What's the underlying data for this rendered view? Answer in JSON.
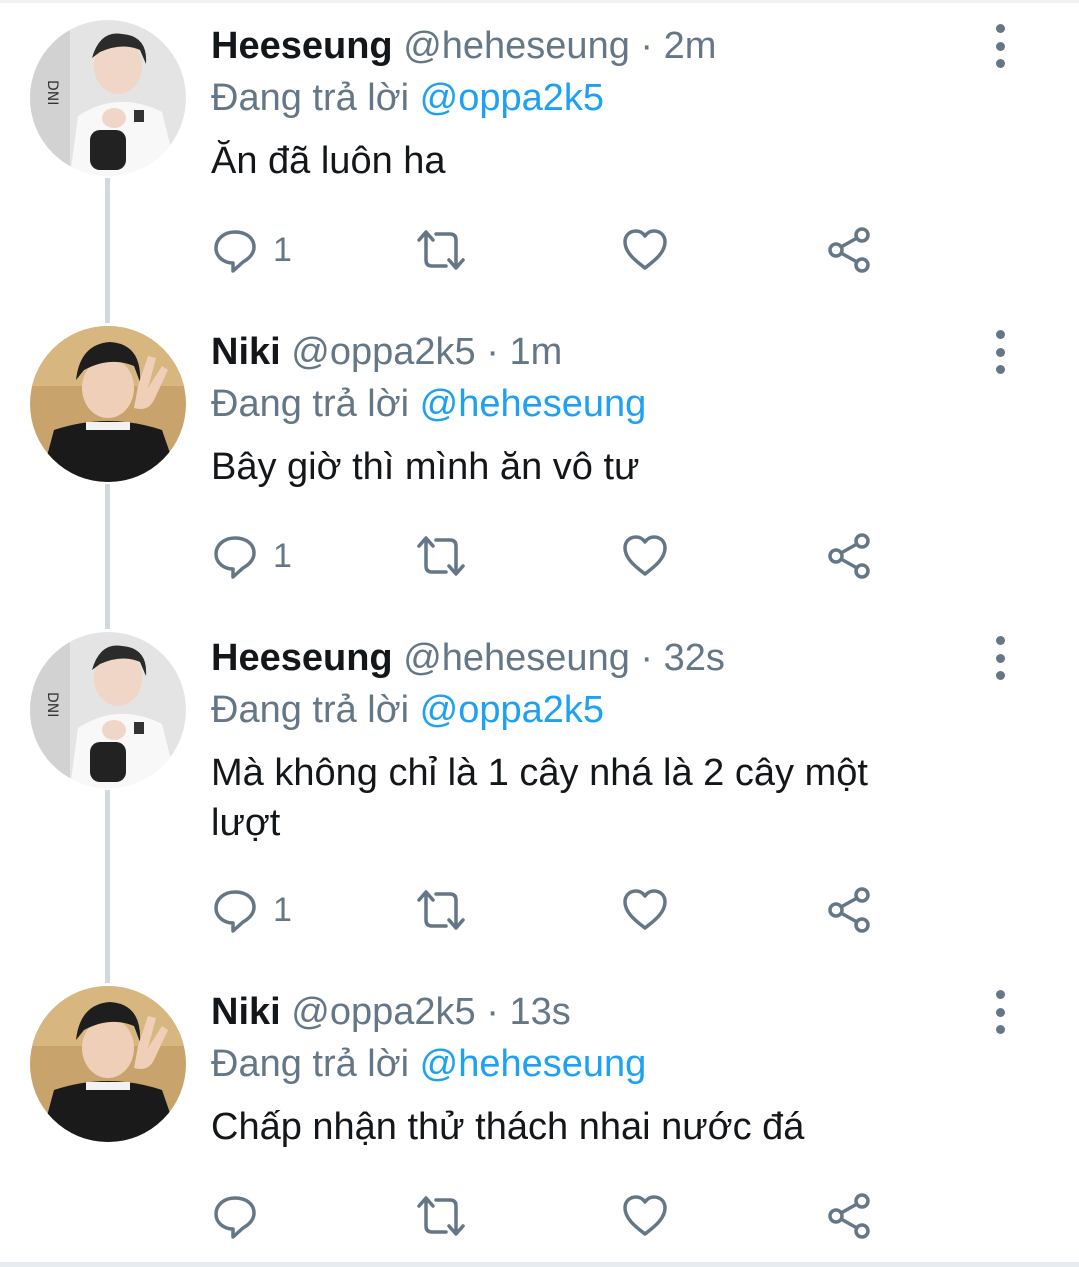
{
  "tweets": [
    {
      "name": "Heeseung",
      "handle": "@heheseung",
      "separator": "·",
      "time": "2m",
      "reply_prefix": "Đang trả lời",
      "reply_to": "@oppa2k5",
      "text": "Ăn đã luôn ha",
      "reply_count": "1",
      "avatar": "heeseung-avatar"
    },
    {
      "name": "Niki",
      "handle": "@oppa2k5",
      "separator": "·",
      "time": "1m",
      "reply_prefix": "Đang trả lời",
      "reply_to": "@heheseung",
      "text": "Bây giờ thì mình ăn vô tư",
      "reply_count": "1",
      "avatar": "niki-avatar"
    },
    {
      "name": "Heeseung",
      "handle": "@heheseung",
      "separator": "·",
      "time": "32s",
      "reply_prefix": "Đang trả lời",
      "reply_to": "@oppa2k5",
      "text": "Mà không chỉ là 1 cây nhá là 2 cây một lượt",
      "reply_count": "1",
      "avatar": "heeseung-avatar"
    },
    {
      "name": "Niki",
      "handle": "@oppa2k5",
      "separator": "·",
      "time": "13s",
      "reply_prefix": "Đang trả lời",
      "reply_to": "@heheseung",
      "text": "Chấp nhận thử thách nhai nước đá",
      "reply_count": "",
      "avatar": "niki-avatar"
    }
  ],
  "icons": {
    "reply": "reply-icon",
    "retweet": "retweet-icon",
    "like": "like-icon",
    "share": "share-icon",
    "more": "more-options-icon"
  },
  "colors": {
    "mention": "#1da1f2",
    "muted": "#657786",
    "text": "#14171a",
    "thread_line": "#cfd9de"
  }
}
